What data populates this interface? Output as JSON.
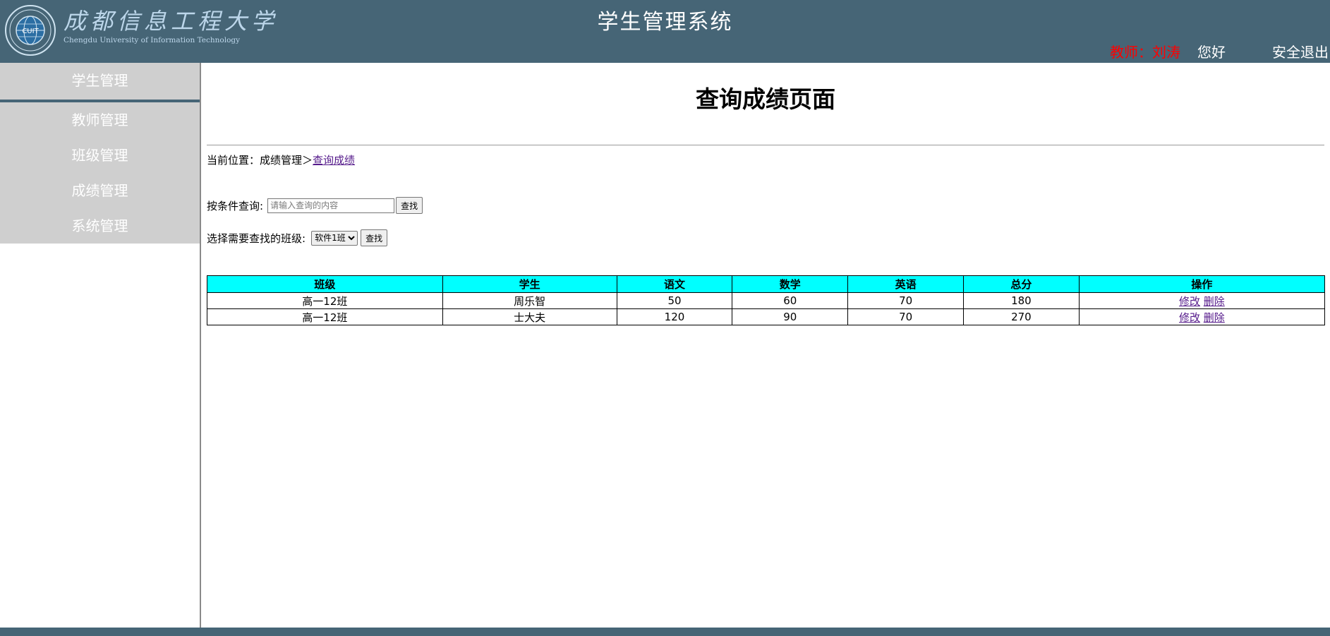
{
  "header": {
    "app_title": "学生管理系统",
    "logo_cn": "成都信息工程大学",
    "logo_en": "Chengdu University of Information Technology",
    "user_role": "教师：",
    "user_name": "刘涛",
    "greeting": "您好",
    "logout": "安全退出"
  },
  "sidebar": {
    "items": [
      {
        "label": "学生管理"
      },
      {
        "label": "教师管理"
      },
      {
        "label": "班级管理"
      },
      {
        "label": "成绩管理"
      },
      {
        "label": "系统管理"
      }
    ]
  },
  "main": {
    "page_title": "查询成绩页面",
    "breadcrumb": {
      "prefix": "当前位置：成绩管理＞",
      "current": "查询成绩"
    },
    "search": {
      "label": "按条件查询:",
      "placeholder": "请输入查询的内容",
      "button": "查找"
    },
    "class_filter": {
      "label": "选择需要查找的班级:",
      "selected": "软件1班",
      "button": "查找"
    },
    "table": {
      "headers": [
        "班级",
        "学生",
        "语文",
        "数学",
        "英语",
        "总分",
        "操作"
      ],
      "rows": [
        {
          "class": "高一12班",
          "student": "周乐智",
          "chinese": "50",
          "math": "60",
          "english": "70",
          "total": "180",
          "edit": "修改",
          "delete": "删除"
        },
        {
          "class": "高一12班",
          "student": "士大夫",
          "chinese": "120",
          "math": "90",
          "english": "70",
          "total": "270",
          "edit": "修改",
          "delete": "删除"
        }
      ]
    }
  },
  "colors": {
    "header_bg": "#466576",
    "menu_bg": "#cfcfcf",
    "table_header_bg": "#00ffff",
    "user_name": "#ff0000"
  }
}
